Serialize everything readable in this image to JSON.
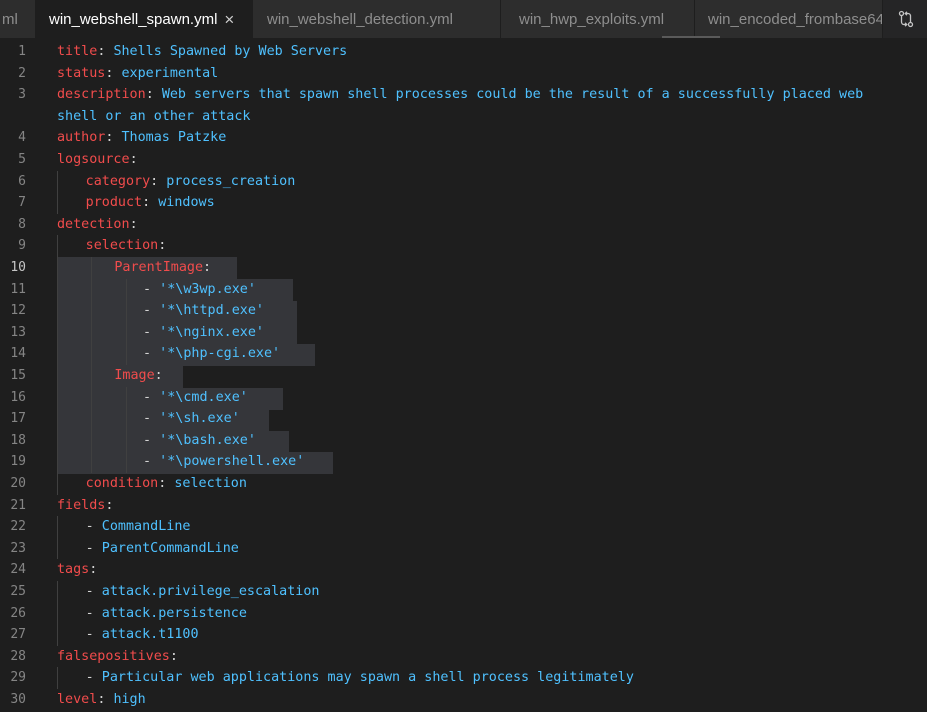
{
  "tabs": [
    {
      "label": "ml",
      "active": false
    },
    {
      "label": "win_webshell_spawn.yml",
      "active": true,
      "close": "×"
    },
    {
      "label": "win_webshell_detection.yml",
      "active": false
    },
    {
      "label": "win_hwp_exploits.yml",
      "active": false
    },
    {
      "label": "win_encoded_frombase64",
      "active": false
    }
  ],
  "tab_actions_icon": "compare-changes-icon",
  "current_line": 10,
  "lines": [
    {
      "n": "1",
      "key": "title",
      "value": "Shells Spawned by Web Servers"
    },
    {
      "n": "2",
      "key": "status",
      "value": "experimental"
    },
    {
      "n": "3",
      "key": "description",
      "value": "Web servers that spawn shell processes could be the result of a successfully placed web"
    },
    {
      "n": "",
      "key": "",
      "value": "shell or an other attack"
    },
    {
      "n": "4",
      "key": "author",
      "value": "Thomas Patzke"
    },
    {
      "n": "5",
      "key": "logsource",
      "value": ""
    },
    {
      "n": "6",
      "key": "category",
      "value": "process_creation"
    },
    {
      "n": "7",
      "key": "product",
      "value": "windows"
    },
    {
      "n": "8",
      "key": "detection",
      "value": ""
    },
    {
      "n": "9",
      "key": "selection",
      "value": ""
    },
    {
      "n": "10",
      "key": "ParentImage",
      "value": ""
    },
    {
      "n": "11",
      "key": "",
      "value": "'*\\w3wp.exe'"
    },
    {
      "n": "12",
      "key": "",
      "value": "'*\\httpd.exe'"
    },
    {
      "n": "13",
      "key": "",
      "value": "'*\\nginx.exe'"
    },
    {
      "n": "14",
      "key": "",
      "value": "'*\\php-cgi.exe'"
    },
    {
      "n": "15",
      "key": "Image",
      "value": ""
    },
    {
      "n": "16",
      "key": "",
      "value": "'*\\cmd.exe'"
    },
    {
      "n": "17",
      "key": "",
      "value": "'*\\sh.exe'"
    },
    {
      "n": "18",
      "key": "",
      "value": "'*\\bash.exe'"
    },
    {
      "n": "19",
      "key": "",
      "value": "'*\\powershell.exe'"
    },
    {
      "n": "20",
      "key": "condition",
      "value": "selection"
    },
    {
      "n": "21",
      "key": "fields",
      "value": ""
    },
    {
      "n": "22",
      "key": "",
      "value": "CommandLine"
    },
    {
      "n": "23",
      "key": "",
      "value": "ParentCommandLine"
    },
    {
      "n": "24",
      "key": "tags",
      "value": ""
    },
    {
      "n": "25",
      "key": "",
      "value": "attack.privilege_escalation"
    },
    {
      "n": "26",
      "key": "",
      "value": "attack.persistence"
    },
    {
      "n": "27",
      "key": "",
      "value": "attack.t1100"
    },
    {
      "n": "28",
      "key": "",
      "value": "falsepositives"
    },
    {
      "n": "29",
      "key": "",
      "value": "Particular web applications may spawn a shell process legitimately"
    },
    {
      "n": "30",
      "key": "level",
      "value": "high"
    }
  ],
  "colors": {
    "background": "#1e1e1e",
    "key": "#f14c4c",
    "value": "#4fc1ff",
    "line_number": "#858585",
    "selection_highlight": "#35363a"
  }
}
